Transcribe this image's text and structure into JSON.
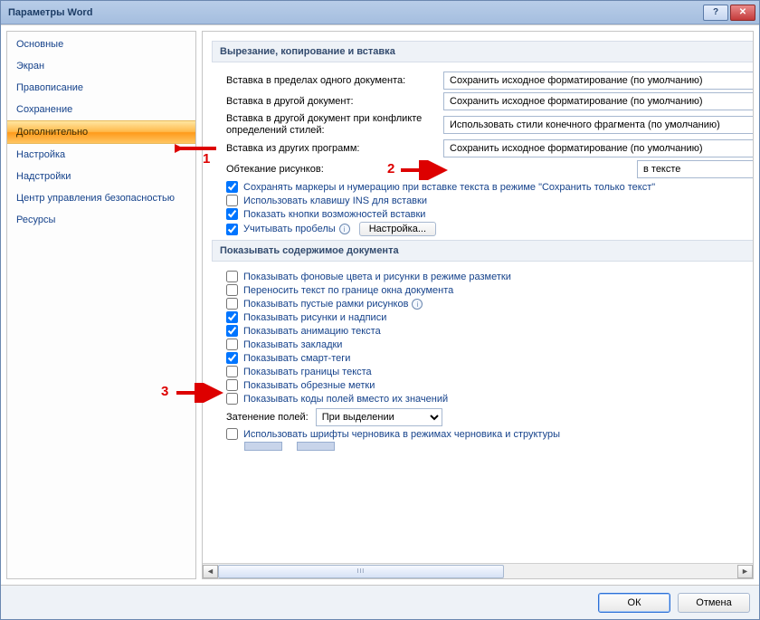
{
  "window": {
    "title": "Параметры Word"
  },
  "sidebar": {
    "items": [
      {
        "label": "Основные"
      },
      {
        "label": "Экран"
      },
      {
        "label": "Правописание"
      },
      {
        "label": "Сохранение"
      },
      {
        "label": "Дополнительно",
        "selected": true
      },
      {
        "label": "Настройка"
      },
      {
        "label": "Надстройки"
      },
      {
        "label": "Центр управления безопасностью"
      },
      {
        "label": "Ресурсы"
      }
    ]
  },
  "section1": {
    "header": "Вырезание, копирование и вставка",
    "rows": {
      "within": {
        "label": "Вставка в пределах одного документа:",
        "value": "Сохранить исходное форматирование (по умолчанию)"
      },
      "other": {
        "label": "Вставка в другой документ:",
        "value": "Сохранить исходное форматирование (по умолчанию)"
      },
      "conflict": {
        "label": "Вставка в другой документ при конфликте определений стилей:",
        "value": "Использовать стили конечного фрагмента (по умолчанию)"
      },
      "programs": {
        "label": "Вставка из других программ:",
        "value": "Сохранить исходное форматирование (по умолчанию)"
      },
      "wrap": {
        "label": "Обтекание рисунков:",
        "value": "в тексте"
      }
    },
    "checks": {
      "keepBullets": {
        "label": "Сохранять маркеры и нумерацию при вставке текста в режиме \"Сохранить только текст\"",
        "checked": true
      },
      "insKey": {
        "label": "Использовать клавишу INS для вставки",
        "checked": false
      },
      "pasteOpts": {
        "label": "Показать кнопки возможностей вставки",
        "checked": true
      },
      "smartPaste": {
        "label": "Учитывать пробелы",
        "checked": true,
        "button": "Настройка..."
      }
    }
  },
  "section2": {
    "header": "Показывать содержимое документа",
    "checks": [
      {
        "label": "Показывать фоновые цвета и рисунки в режиме разметки",
        "checked": false
      },
      {
        "label": "Переносить текст по границе окна документа",
        "checked": false
      },
      {
        "label": "Показывать пустые рамки рисунков",
        "checked": false,
        "info": true
      },
      {
        "label": "Показывать рисунки и надписи",
        "checked": true
      },
      {
        "label": "Показывать анимацию текста",
        "checked": true
      },
      {
        "label": "Показывать закладки",
        "checked": false
      },
      {
        "label": "Показывать смарт-теги",
        "checked": true
      },
      {
        "label": "Показывать границы текста",
        "checked": false
      },
      {
        "label": "Показывать обрезные метки",
        "checked": false
      },
      {
        "label": "Показывать коды полей вместо их значений",
        "checked": false
      }
    ],
    "shading": {
      "label": "Затенение полей:",
      "value": "При выделении"
    },
    "draftFont": {
      "label": "Использовать шрифты черновика в режимах черновика и структуры",
      "checked": false
    }
  },
  "buttons": {
    "ok": "ОК",
    "cancel": "Отмена"
  },
  "anno": {
    "n1": "1",
    "n2": "2",
    "n3": "3"
  }
}
